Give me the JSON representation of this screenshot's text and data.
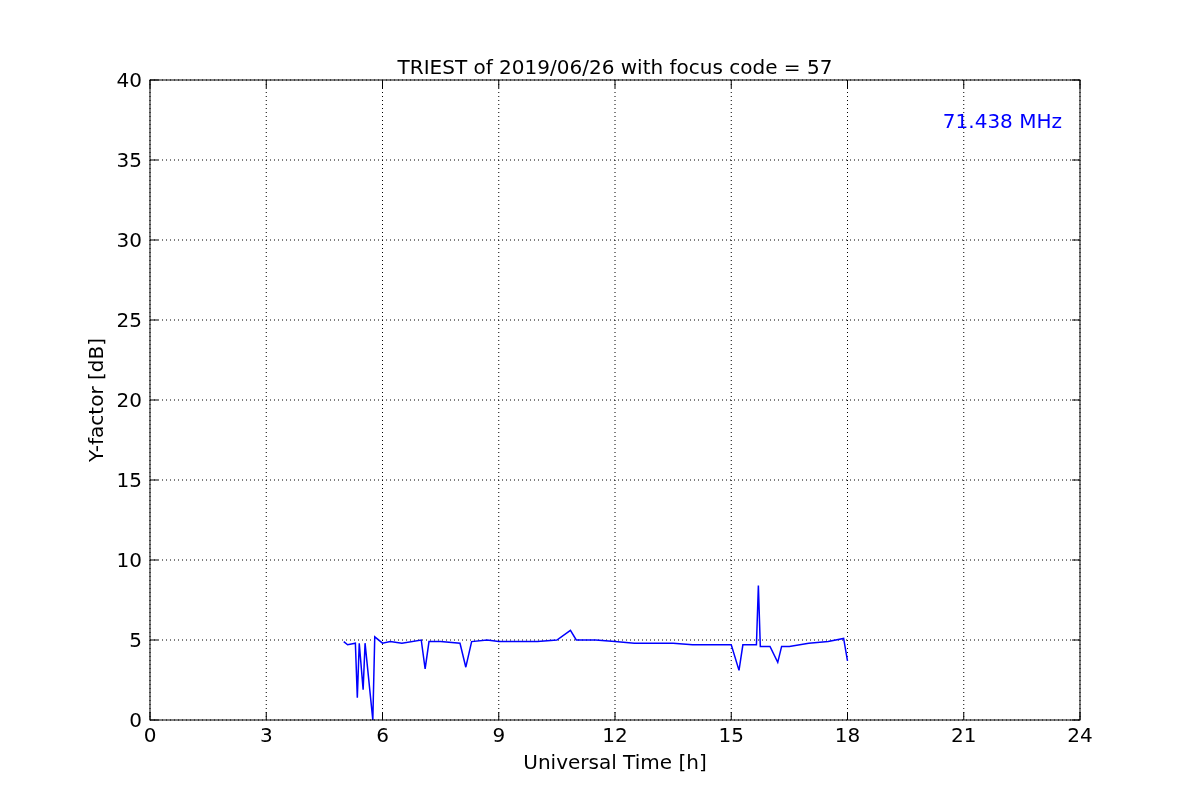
{
  "figure": {
    "chart_data": {
      "type": "line",
      "title": "TRIEST of 2019/06/26 with focus code = 57",
      "xlabel": "Universal Time [h]",
      "ylabel": "Y-factor [dB]",
      "xlim": [
        0,
        24
      ],
      "ylim": [
        0,
        40
      ],
      "xticks": [
        0,
        3,
        6,
        9,
        12,
        15,
        18,
        21,
        24
      ],
      "yticks": [
        0,
        5,
        10,
        15,
        20,
        25,
        30,
        35,
        40
      ],
      "x": [
        5.0,
        5.1,
        5.3,
        5.35,
        5.4,
        5.5,
        5.55,
        5.75,
        5.8,
        6.0,
        6.2,
        6.5,
        7.0,
        7.1,
        7.2,
        7.5,
        8.0,
        8.15,
        8.3,
        8.7,
        9.0,
        9.5,
        10.0,
        10.5,
        10.85,
        11.0,
        11.5,
        12.0,
        12.5,
        13.0,
        13.5,
        14.0,
        14.5,
        15.0,
        15.2,
        15.3,
        15.65,
        15.7,
        15.75,
        16.0,
        16.2,
        16.3,
        16.5,
        17.0,
        17.5,
        17.9,
        18.0
      ],
      "grid": true,
      "series": [
        {
          "color": "#0000ff",
          "values": [
            4.9,
            4.7,
            4.8,
            1.4,
            4.8,
            1.9,
            4.8,
            0,
            5.2,
            4.8,
            4.9,
            4.8,
            5.0,
            3.2,
            4.9,
            4.9,
            4.8,
            3.3,
            4.9,
            5.0,
            4.9,
            4.9,
            4.9,
            5.0,
            5.6,
            5.0,
            5.0,
            4.9,
            4.8,
            4.8,
            4.8,
            4.7,
            4.7,
            4.7,
            3.1,
            4.7,
            4.7,
            8.4,
            4.6,
            4.6,
            3.6,
            4.6,
            4.6,
            4.8,
            4.9,
            5.1,
            3.7
          ]
        }
      ],
      "annotations": [
        {
          "text": "71.438 MHz"
        }
      ]
    }
  }
}
